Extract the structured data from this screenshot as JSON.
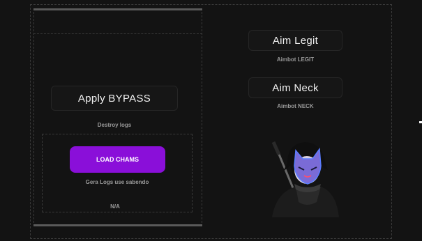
{
  "left_panel": {
    "bypass_label": "Apply BYPASS",
    "bypass_caption": "Destroy logs",
    "chams_label": "LOAD CHAMS",
    "chams_caption": "Gera Logs use sabendo",
    "status_text": "N/A"
  },
  "right_panel": {
    "aim_legit_label": "Aim Legit",
    "aim_legit_caption": "Aimbot LEGIT",
    "aim_neck_label": "Aim Neck",
    "aim_neck_caption": "Aimbot NECK"
  },
  "colors": {
    "background": "#131313",
    "accent_purple": "#8a0fd9",
    "mask_blue": "#5a7cff"
  },
  "icons": {
    "character": "masked-ninja-avatar"
  }
}
